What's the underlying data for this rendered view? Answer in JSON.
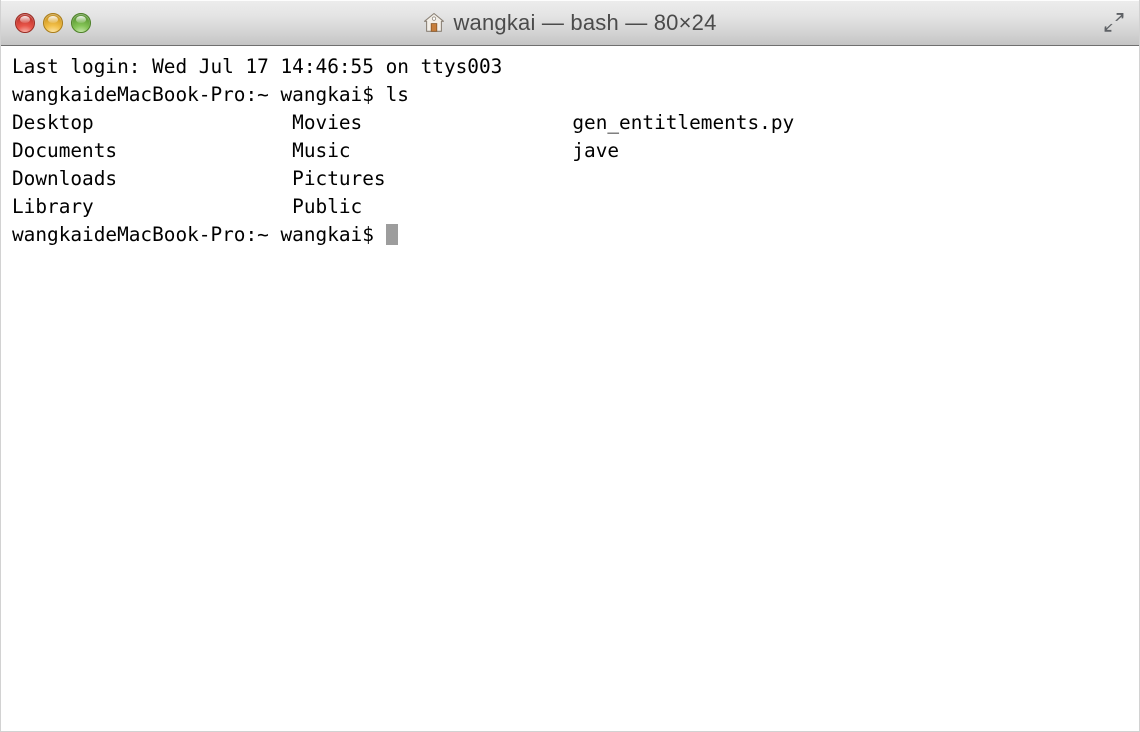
{
  "window": {
    "title": "wangkai — bash — 80×24",
    "title_icon": "home-icon",
    "controls": {
      "close_label": "",
      "minimize_label": "",
      "zoom_label": "",
      "fullscreen_label": ""
    }
  },
  "terminal": {
    "columns": 80,
    "rows": 24,
    "shell": "bash",
    "user": "wangkai",
    "background_color": "#ffffff",
    "foreground_color": "#000000",
    "cursor_color": "#9d9d9d",
    "lines": [
      "Last login: Wed Jul 17 14:46:55 on ttys003",
      "wangkaideMacBook-Pro:~ wangkai$ ls",
      "Desktop                 Movies                  gen_entitlements.py",
      "Documents               Music                   jave",
      "Downloads               Pictures",
      "Library                 Public",
      "wangkaideMacBook-Pro:~ wangkai$ "
    ],
    "last_login": {
      "label": "Last login:",
      "weekday": "Wed",
      "month": "Jul",
      "day": "17",
      "time": "14:46:55",
      "on": "on",
      "tty": "ttys003"
    },
    "prompt": "wangkaideMacBook-Pro:~ wangkai$",
    "command": "ls",
    "listing": {
      "column_1": [
        "Desktop",
        "Documents",
        "Downloads",
        "Library"
      ],
      "column_2": [
        "Movies",
        "Music",
        "Pictures",
        "Public"
      ],
      "column_3": [
        "gen_entitlements.py",
        "jave"
      ]
    }
  }
}
